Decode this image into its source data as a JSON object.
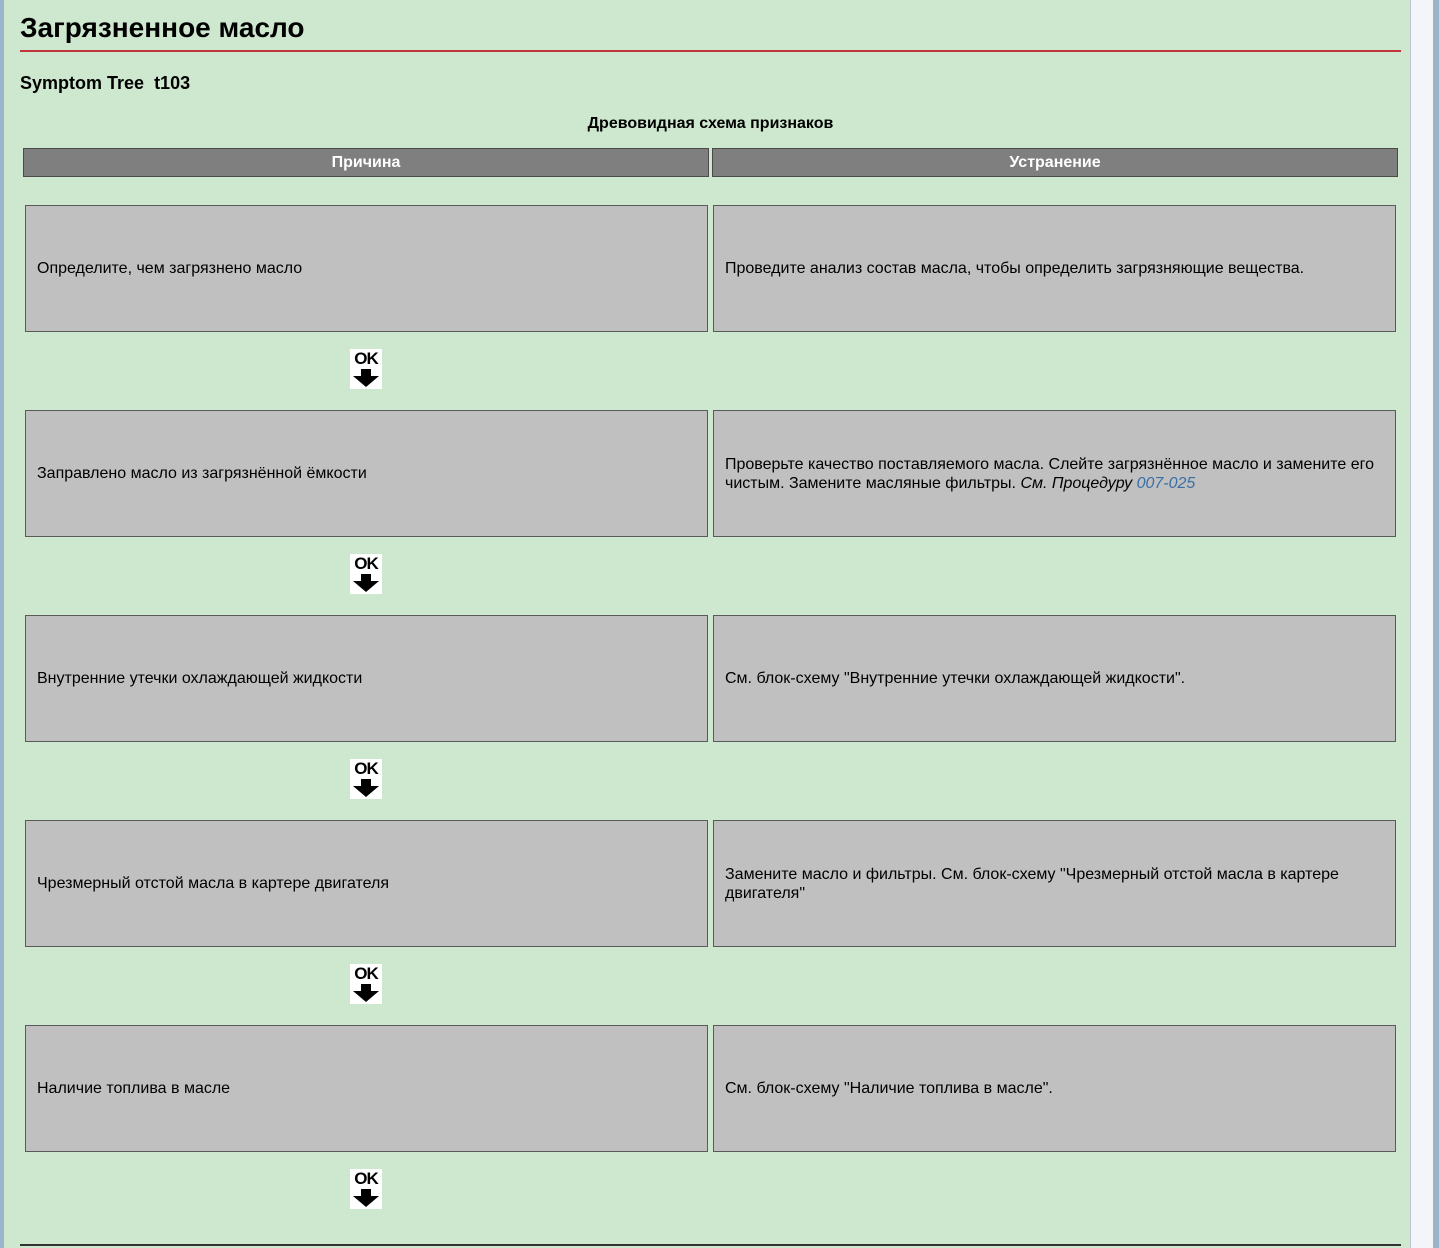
{
  "page": {
    "title": "Загрязненное масло",
    "symptom_label": "Symptom Tree",
    "symptom_code": "t103",
    "table_caption": "Древовидная схема признаков"
  },
  "table": {
    "headers": {
      "cause": "Причина",
      "remedy": "Устранение"
    },
    "steps": [
      {
        "cause": "Определите, чем загрязнено масло",
        "remedy": "Проведите анализ состав масла, чтобы определить загрязняющие вещества.",
        "result": "OK"
      },
      {
        "cause": "Заправлено масло из загрязнённой ёмкости",
        "remedy": "Проверьте качество поставляемого масла. Слейте загрязнённое масло и замените его чистым. Замените масляные фильтры.",
        "remedy_ref_prefix": "См. Процедуру",
        "remedy_ref_link": "007-025",
        "result": "OK"
      },
      {
        "cause": "Внутренние утечки охлаждающей жидкости",
        "remedy": "См. блок-схему \"Внутренние утечки охлаждающей жидкости\".",
        "result": "OK"
      },
      {
        "cause": "Чрезмерный отстой масла в картере двигателя",
        "remedy": "Замените масло и фильтры. См. блок-схему \"Чрезмерный отстой масла в картере двигателя\"",
        "result": "OK"
      },
      {
        "cause": "Наличие топлива в масле",
        "remedy": "См. блок-схему \"Наличие топлива в масле\".",
        "result": "OK"
      }
    ]
  },
  "icons": {
    "result_arrow": "ok-down-arrow-icon"
  },
  "colors": {
    "background": "#cde8cf",
    "title_rule": "#c0363b",
    "header_fill": "#7f7f7f",
    "cell_fill": "#c0c0c0",
    "link": "#3a6ea5"
  }
}
